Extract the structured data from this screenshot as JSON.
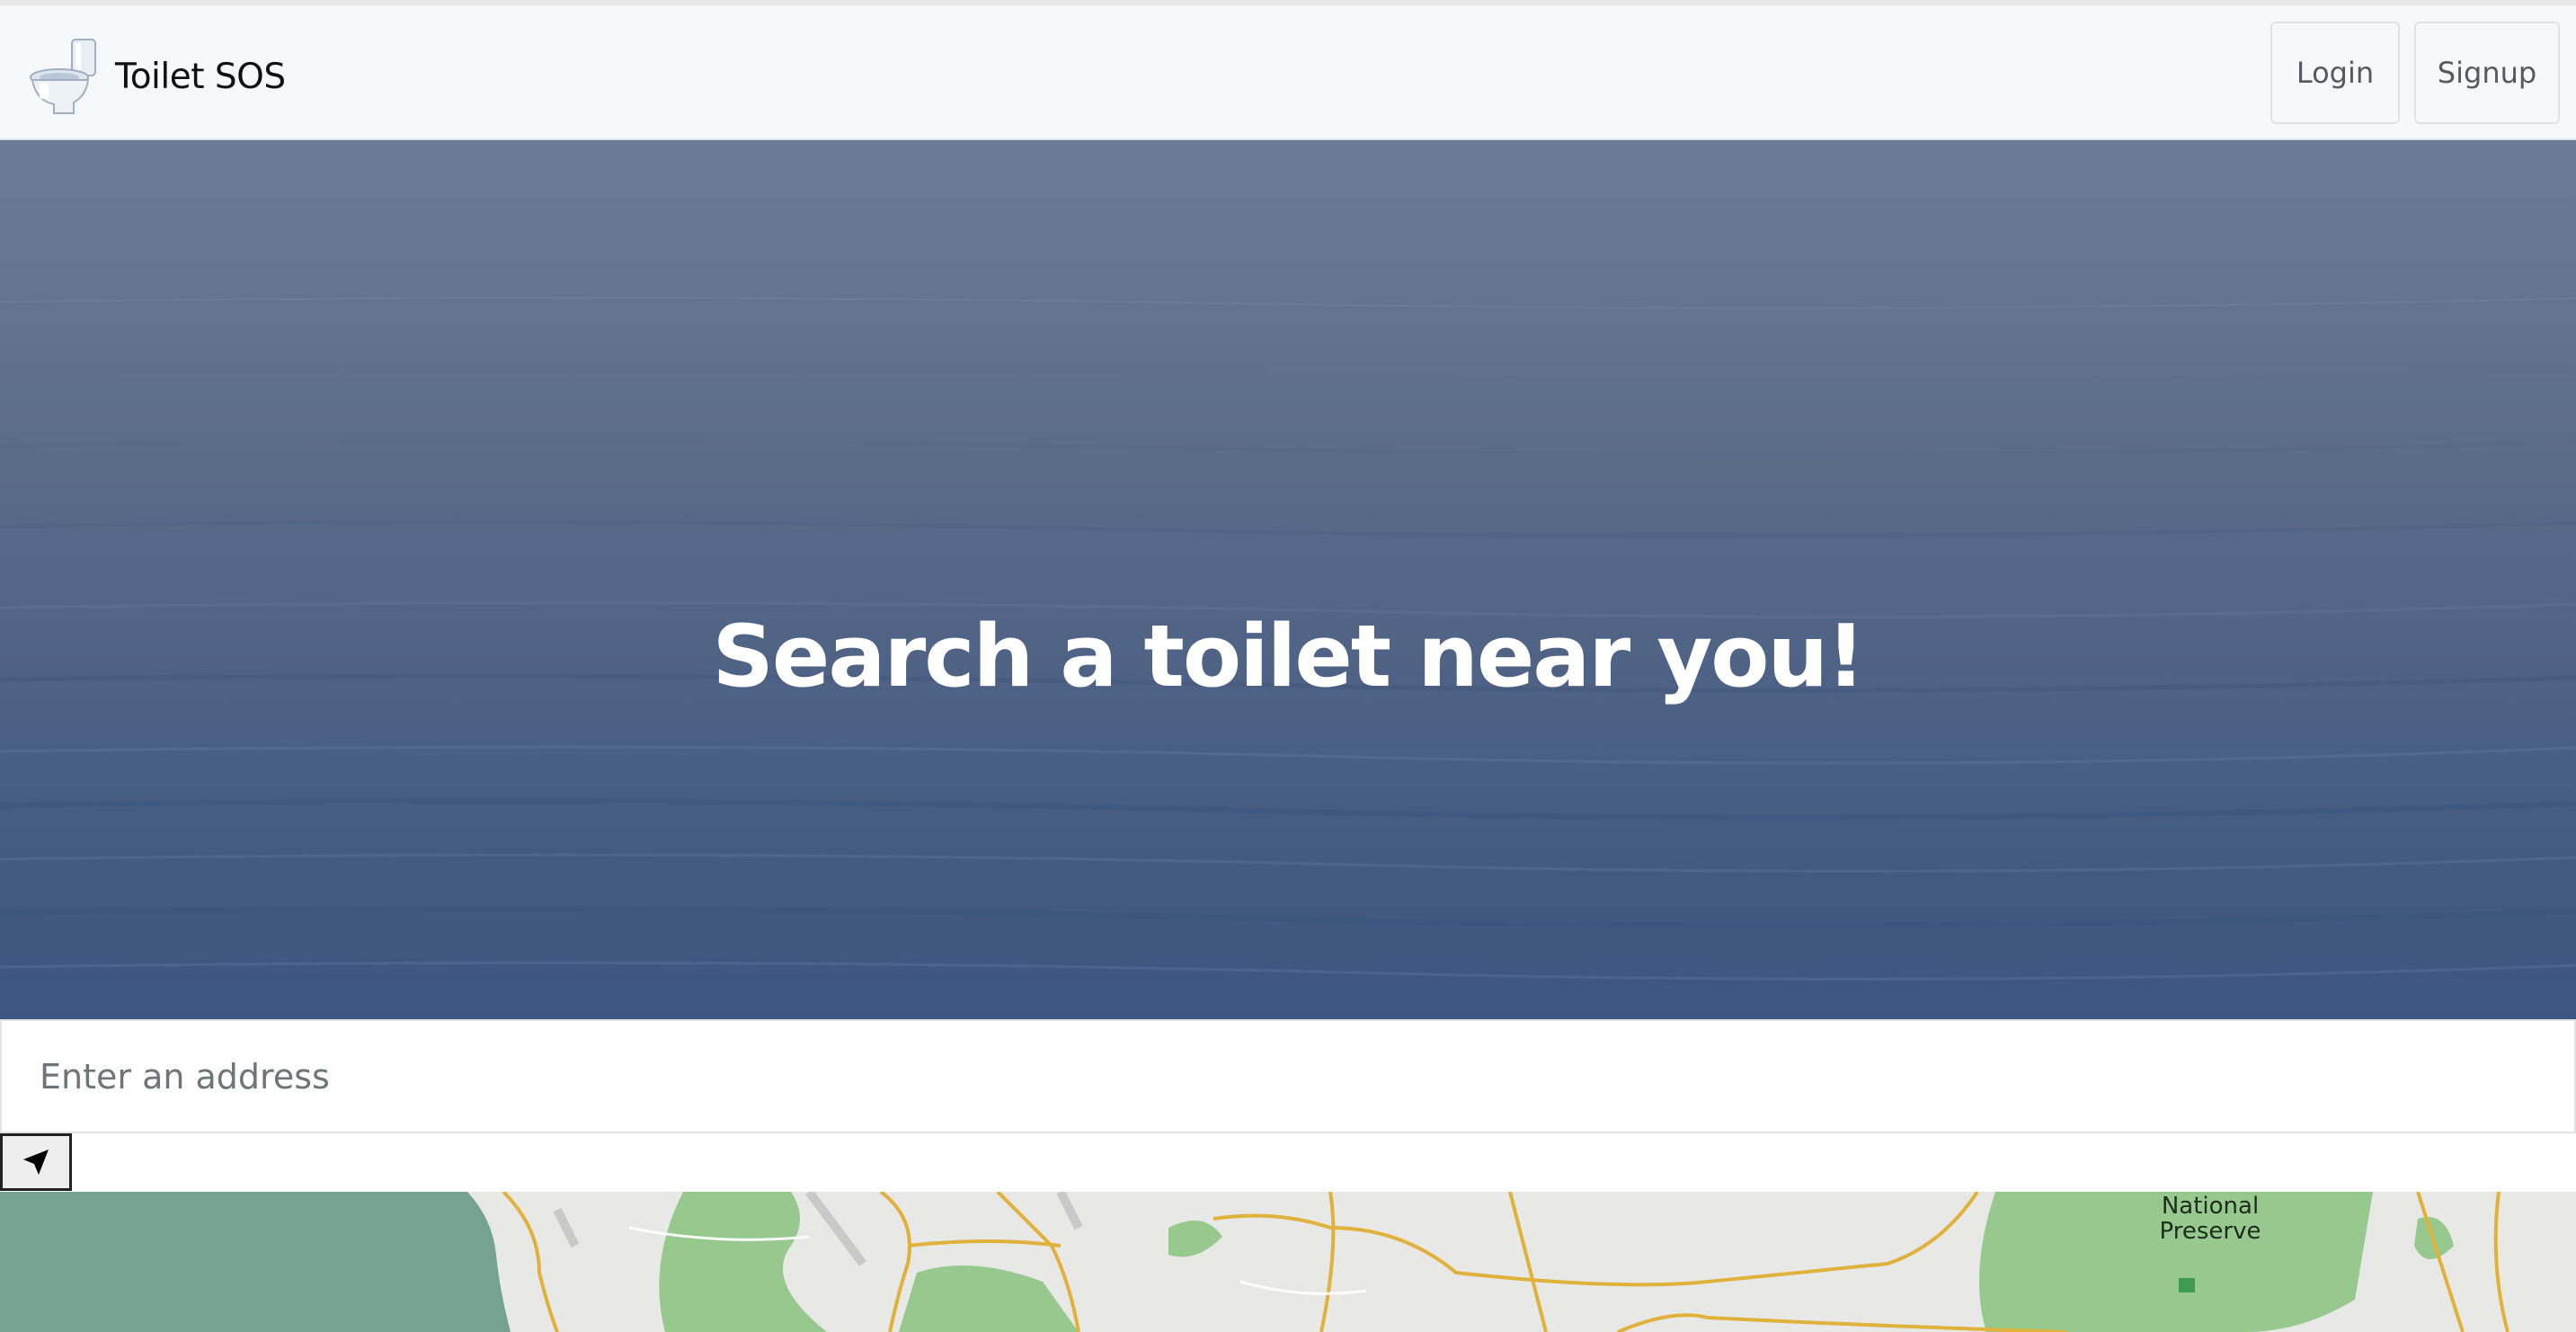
{
  "app": {
    "brand_name": "Toilet SOS",
    "brand_icon": "toilet-icon"
  },
  "nav": {
    "login_label": "Login",
    "signup_label": "Signup"
  },
  "hero": {
    "title": "Search a toilet near you!",
    "background": "calm sea"
  },
  "search": {
    "placeholder": "Enter an address",
    "value": ""
  },
  "locate_button": {
    "icon": "navigation-arrow-icon"
  },
  "map": {
    "label_lines": [
      "National",
      "Preserve"
    ]
  },
  "colors": {
    "navbar_bg": "#f7f8f9",
    "hero_top": "#6c7b96",
    "hero_bottom": "#3d5682",
    "map_water": "#76a391",
    "map_park": "#97c98f",
    "map_road": "#e0b23b"
  }
}
